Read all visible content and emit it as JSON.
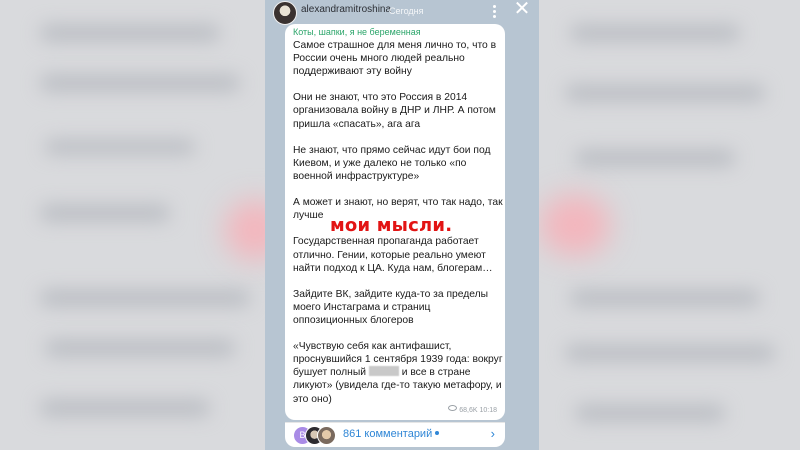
{
  "story": {
    "username": "alexandramitroshina",
    "time_label": "Сегодня",
    "channel_name": "Коты, шапки, я не беременная",
    "paragraphs": [
      "Самое страшное для меня лично то, что в России очень много людей реально поддерживают эту войну",
      "Они не знают, что это Россия в 2014 организовала войну в ДНР и ЛНР. А потом пришла «спасать», ага ага",
      "Не знают, что прямо сейчас идут бои под Киевом, и уже далеко не только «по военной инфраструктуре»",
      "А может и знают, но верят, что так надо, так лучше",
      "Государственная пропаганда работает отлично. Гении, которые реально умеют найти подход к ЦА. Куда нам, блогерам…",
      "Зайдите ВК, зайдите куда-то за пределы моего Инстаграма и страниц оппозиционных блогеров"
    ],
    "quote_before": "«Чувствую себя как антифашист, проснувшийся 1 сентября 1939 года: вокруг бушует полный ",
    "quote_after": " и все в стране ликуют» (увидела где-то такую метафору, и это оно)",
    "views": "68,6K",
    "post_time": "10:18",
    "comments_avatar_letter": "В",
    "comments_label": "861 комментарий",
    "sticker_text": "мои мысли."
  },
  "icons": [
    "more-dots-icon",
    "close-icon",
    "views-eye-icon",
    "chevron-right-icon"
  ],
  "colors": {
    "channel": "#2ba56a",
    "link": "#2f86d6",
    "sticker": "#e21414",
    "story_bg": "#b7c5d2"
  }
}
